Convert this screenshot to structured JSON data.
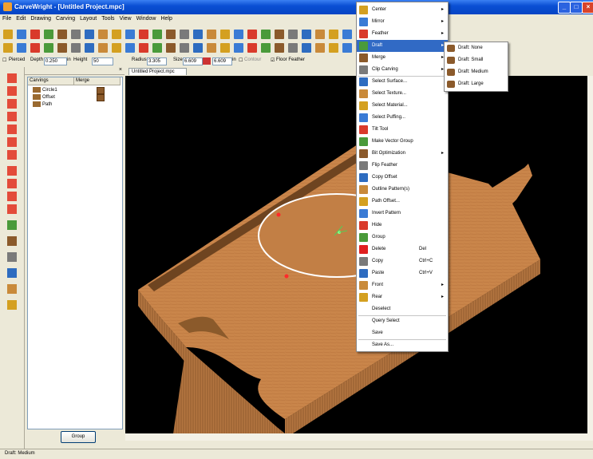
{
  "window": {
    "title": "CarveWright - [Untitled Project.mpc]"
  },
  "menubar": [
    "File",
    "Edit",
    "Drawing",
    "Carving",
    "Layout",
    "Tools",
    "View",
    "Window",
    "Help"
  ],
  "propbar": {
    "pierced_label": "Pierced",
    "depth_label": "Depth",
    "depth_value": "0.250",
    "height_unit": "in",
    "height_label": "Height",
    "height_value": "50",
    "radius_label": "Radius",
    "radius_value": "3.305",
    "size_label": "Size",
    "size_w": "6.609",
    "size_h": "6.609",
    "size_unit": "in",
    "contour_label": "Contour",
    "floor_feather_label": "Floor Feather"
  },
  "panel": {
    "col_carvings": "Carvings",
    "col_merge": "Merge",
    "items": [
      {
        "label": "Circle1"
      },
      {
        "label": "Offset"
      },
      {
        "label": "Path"
      }
    ],
    "group_button": "Group"
  },
  "viewport": {
    "tab": "Untitled Project.mpc"
  },
  "context_menu": [
    {
      "label": "Center",
      "icon": "center-icon",
      "submenu": true
    },
    {
      "label": "Mirror",
      "icon": "mirror-icon",
      "submenu": true
    },
    {
      "label": "Feather",
      "icon": "feather-icon",
      "submenu": true
    },
    {
      "label": "Draft",
      "icon": "draft-icon",
      "submenu": true,
      "highlighted": true
    },
    {
      "label": "Merge",
      "icon": "merge-icon",
      "submenu": true
    },
    {
      "label": "Clip Carving",
      "icon": "clip-carving-icon",
      "submenu": true
    },
    {
      "label": "Select Surface...",
      "icon": "select-surface-icon"
    },
    {
      "label": "Select Texture...",
      "icon": "select-texture-icon"
    },
    {
      "label": "Select Material...",
      "icon": "select-material-icon"
    },
    {
      "label": "Select Puffing...",
      "icon": "select-puffing-icon"
    },
    {
      "label": "Tilt Tool",
      "icon": "tilt-tool-icon"
    },
    {
      "label": "Make Vector Group",
      "icon": "vector-group-icon"
    },
    {
      "label": "Bit Optimization",
      "icon": "bit-optimization-icon",
      "submenu": true
    },
    {
      "label": "Flip Feather",
      "icon": "flip-feather-icon"
    },
    {
      "label": "Copy Offset",
      "icon": "copy-offset-icon"
    },
    {
      "label": "Outline Pattern(s)",
      "icon": "outline-pattern-icon"
    },
    {
      "label": "Path Offset...",
      "icon": "path-offset-icon"
    },
    {
      "label": "Invert Pattern",
      "icon": "invert-pattern-icon"
    },
    {
      "label": "Hide",
      "icon": "hide-icon"
    },
    {
      "label": "Group",
      "icon": "group-icon"
    },
    {
      "label": "Delete",
      "icon": "delete-icon",
      "shortcut": "Del"
    },
    {
      "label": "Copy",
      "icon": "copy-icon",
      "shortcut": "Ctrl+C"
    },
    {
      "label": "Paste",
      "icon": "paste-icon",
      "shortcut": "Ctrl+V"
    },
    {
      "label": "Front",
      "icon": "front-icon",
      "submenu": true
    },
    {
      "label": "Rear",
      "icon": "rear-icon",
      "submenu": true
    },
    {
      "label": "Deselect",
      "icon": ""
    },
    {
      "label": "Query Select",
      "icon": ""
    },
    {
      "label": "Save",
      "icon": ""
    },
    {
      "label": "Save As...",
      "icon": ""
    }
  ],
  "draft_submenu": [
    "Draft: None",
    "Draft: Small",
    "Draft: Medium",
    "Draft: Large"
  ],
  "status": {
    "text": "Draft: Medium"
  },
  "colors": {
    "board": "#c9854a",
    "board_edge": "#a96a35",
    "menu_highlight": "#316ac5",
    "titlebar": "#0a4fd4"
  }
}
